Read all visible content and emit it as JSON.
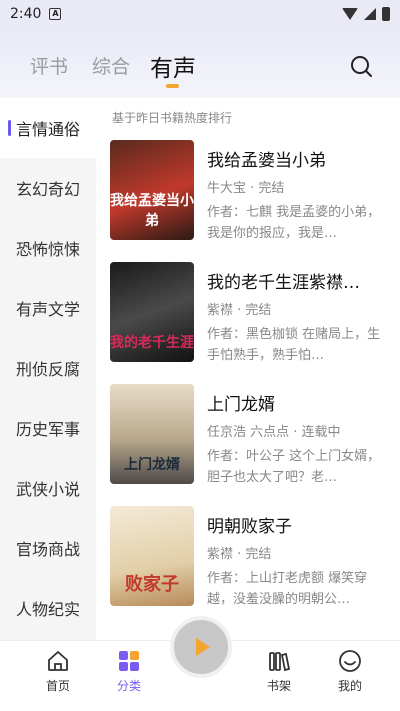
{
  "status_bar": {
    "time": "2:40",
    "notif_badge": "A"
  },
  "tabs": [
    {
      "label": "评书"
    },
    {
      "label": "综合"
    },
    {
      "label": "有声"
    }
  ],
  "active_tab": "有声",
  "colors": {
    "accent": "#f5a331",
    "selection": "#6b5cf0",
    "nav_active": "#7a5cf0"
  },
  "sidebar": {
    "items": [
      {
        "label": "言情通俗"
      },
      {
        "label": "玄幻奇幻"
      },
      {
        "label": "恐怖惊悚"
      },
      {
        "label": "有声文学"
      },
      {
        "label": "刑侦反腐"
      },
      {
        "label": "历史军事"
      },
      {
        "label": "武侠小说"
      },
      {
        "label": "官场商战"
      },
      {
        "label": "人物纪实"
      }
    ]
  },
  "content": {
    "caption": "基于昨日书籍热度排行",
    "books": [
      {
        "title": "我给孟婆当小弟",
        "meta": "牛大宝 · 完结",
        "desc": "作者：七麒 我是孟婆的小弟，我是你的报应，我是…",
        "cover_text": "我给孟婆当小弟"
      },
      {
        "title": "我的老千生涯紫襟…",
        "meta": "紫襟 · 完结",
        "desc": "作者：黑色枷锁 在赌局上，生手怕熟手，熟手怕…",
        "cover_text": "我的老千生涯"
      },
      {
        "title": "上门龙婿",
        "meta": "任京浩 六点点 · 连载中",
        "desc": "作者：叶公子 这个上门女婿，胆子也太大了吧？老…",
        "cover_text": "上门龙婿"
      },
      {
        "title": "明朝败家子",
        "meta": "紫襟 · 完结",
        "desc": "作者：上山打老虎额 爆笑穿越，没羞没臊的明朝公…",
        "cover_text": "败家子"
      }
    ]
  },
  "bottom_nav": [
    {
      "label": "首页"
    },
    {
      "label": "分类"
    },
    {
      "label": "书架"
    },
    {
      "label": "我的"
    }
  ]
}
